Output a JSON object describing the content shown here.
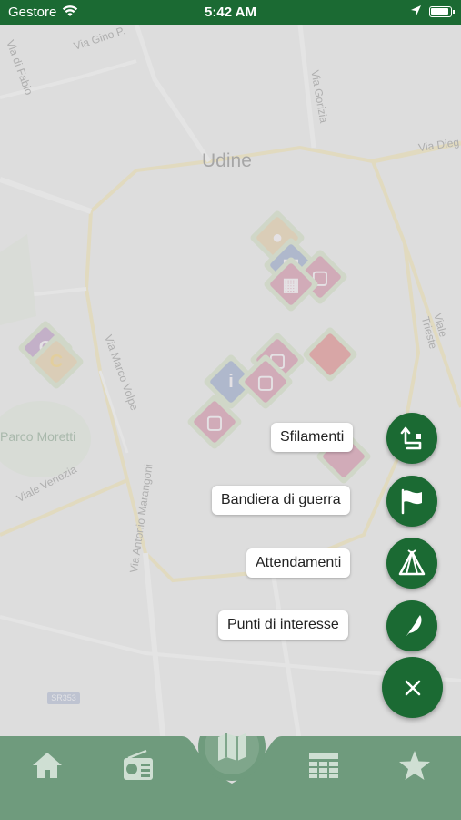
{
  "status_bar": {
    "carrier": "Gestore",
    "time": "5:42 AM"
  },
  "map": {
    "city_label": "Udine",
    "park_label": "Parco Moretti",
    "road_labels": [
      "Via Gino P.",
      "Via Gorizia",
      "Via Dieg",
      "Viale Trieste",
      "Via Marco Volpe",
      "Viale Venezia",
      "Via Antonio Marangoni",
      "Via di Fabio"
    ],
    "road_tag": "SR353"
  },
  "fab_menu": {
    "items": [
      {
        "label": "Sfilamenti",
        "icon": "route-icon"
      },
      {
        "label": "Bandiera di guerra",
        "icon": "flag-icon"
      },
      {
        "label": "Attendamenti",
        "icon": "tent-icon"
      },
      {
        "label": "Punti di interesse",
        "icon": "feather-icon"
      }
    ],
    "close_icon": "close-icon"
  },
  "tabbar": {
    "tabs": [
      {
        "name": "home",
        "icon": "home-icon"
      },
      {
        "name": "radio",
        "icon": "radio-icon"
      },
      {
        "name": "map",
        "icon": "map-icon"
      },
      {
        "name": "schedule",
        "icon": "table-icon"
      },
      {
        "name": "favorites",
        "icon": "star-icon"
      }
    ]
  },
  "colors": {
    "brand_green": "#1b6a33",
    "tabbar_green": "#6f9b7d",
    "label_bg": "#ffffff"
  }
}
